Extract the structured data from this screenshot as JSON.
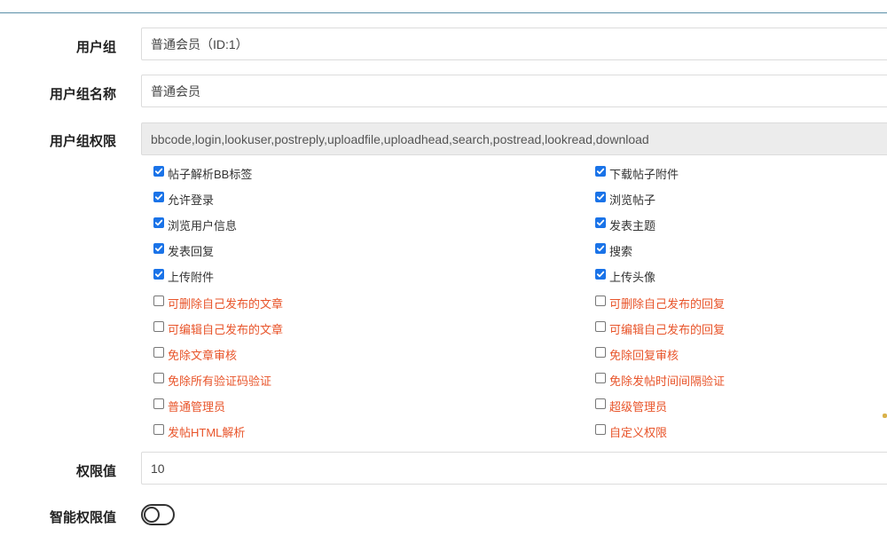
{
  "form": {
    "group_label": "用户组",
    "group_value": "普通会员（ID:1）",
    "name_label": "用户组名称",
    "name_value": "普通会员",
    "perms_label": "用户组权限",
    "perms_value": "bbcode,login,lookuser,postreply,uploadfile,uploadhead,search,postread,lookread,download",
    "level_label": "权限值",
    "level_value": "10",
    "smart_label": "智能权限值",
    "smart_enabled": false
  },
  "permissions": [
    {
      "label": "帖子解析BB标签",
      "checked": true
    },
    {
      "label": "下载帖子附件",
      "checked": true
    },
    {
      "label": "允许登录",
      "checked": true
    },
    {
      "label": "浏览帖子",
      "checked": true
    },
    {
      "label": "浏览用户信息",
      "checked": true
    },
    {
      "label": "发表主题",
      "checked": true
    },
    {
      "label": "发表回复",
      "checked": true
    },
    {
      "label": "搜索",
      "checked": true
    },
    {
      "label": "上传附件",
      "checked": true
    },
    {
      "label": "上传头像",
      "checked": true
    },
    {
      "label": "可删除自己发布的文章",
      "checked": false
    },
    {
      "label": "可删除自己发布的回复",
      "checked": false
    },
    {
      "label": "可编辑自己发布的文章",
      "checked": false
    },
    {
      "label": "可编辑自己发布的回复",
      "checked": false
    },
    {
      "label": "免除文章审核",
      "checked": false
    },
    {
      "label": "免除回复审核",
      "checked": false
    },
    {
      "label": "免除所有验证码验证",
      "checked": false
    },
    {
      "label": "免除发帖时间间隔验证",
      "checked": false
    },
    {
      "label": "普通管理员",
      "checked": false
    },
    {
      "label": "超级管理员",
      "checked": false
    },
    {
      "label": "发帖HTML解析",
      "checked": false
    },
    {
      "label": "自定义权限",
      "checked": false
    }
  ],
  "colors": {
    "checked_accent": "#1a73e8",
    "unchecked_text": "#e8542a"
  }
}
